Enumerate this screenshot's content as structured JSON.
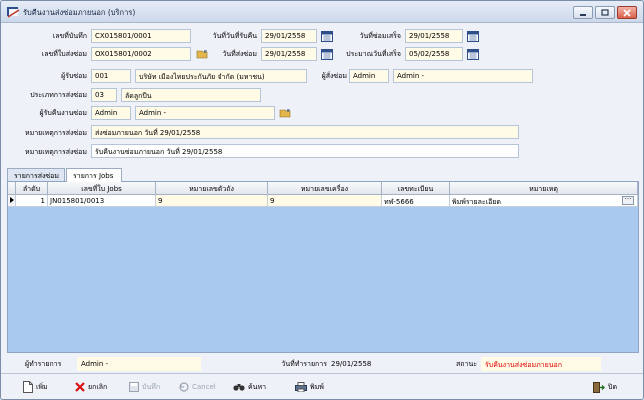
{
  "window": {
    "title": "รับคืนงานส่งซ่อมภายนอก (บริการ)"
  },
  "form": {
    "doc_no": {
      "label": "เลขที่บันทึก",
      "value": "CX015801/0001"
    },
    "receive_date": {
      "label": "วันที่วันที่รับคืน",
      "value": "29/01/2558"
    },
    "finish_date": {
      "label": "วันที่ซ่อมเสร็จ",
      "value": "29/01/2558"
    },
    "send_no": {
      "label": "เลขที่ใบส่งซ่อม",
      "value": "OX015801/0002"
    },
    "send_date": {
      "label": "วันที่ส่งซ่อม",
      "value": "29/01/2558"
    },
    "est_finish": {
      "label": "ประมาณวันที่เสร็จ",
      "value": "05/02/2558"
    },
    "repairer": {
      "label": "ผู้รับซ่อม",
      "code": "001",
      "name": "บริษัท เมืองไทยประกันภัย จำกัด (มหาชน)"
    },
    "sender": {
      "label": "ผู้สั่งซ่อม",
      "code": "Admin",
      "name": "Admin -"
    },
    "repair_type": {
      "label": "ประเภทการส่งซ่อม",
      "code": "03",
      "name": "ลัดลูกปืน"
    },
    "receiver": {
      "label": "ผู้รับคืนงานซ่อม",
      "code": "Admin",
      "name": "Admin -"
    },
    "send_note": {
      "label": "หมายเหตุการส่งซ่อม",
      "value": "ส่งซ่อมภายนอก วันที่ 29/01/2558"
    },
    "return_note": {
      "label": "หมายเหตุการส่งซ่อม",
      "value": "รับคืนงานซ่อมภายนอก วันที่ 29/01/2558"
    }
  },
  "tabs": [
    "รายการส่งซ่อม",
    "รายการ Jobs"
  ],
  "grid": {
    "columns": [
      "ลำดับ",
      "เลขที่ใบ Jobs",
      "หมายเลขตัวถัง",
      "หมายเลขเครื่อง",
      "เลขทะเบียน",
      "หมายเหตุ"
    ],
    "rows": [
      [
        "1",
        "JN015801/0013",
        "9",
        "9",
        "ทฬ-5666",
        "พิมพ์รายละเอียด"
      ]
    ]
  },
  "status": {
    "creator_label": "ผู้ทำรายการ",
    "creator": "Admin -",
    "date_label": "วันที่ทำรายการ",
    "date": "29/01/2558",
    "state_label": "สถานะ",
    "state": "รับคืนงานส่งซ่อมภายนอก",
    "state_color": "#e00000"
  },
  "toolbar": {
    "add": "เพิ่ม",
    "cancel_doc": "ยกเลิก",
    "save": "บันทึก",
    "cancel": "Cancel",
    "search": "ค้นหา",
    "print": "พิมพ์",
    "close": "ปิด"
  }
}
